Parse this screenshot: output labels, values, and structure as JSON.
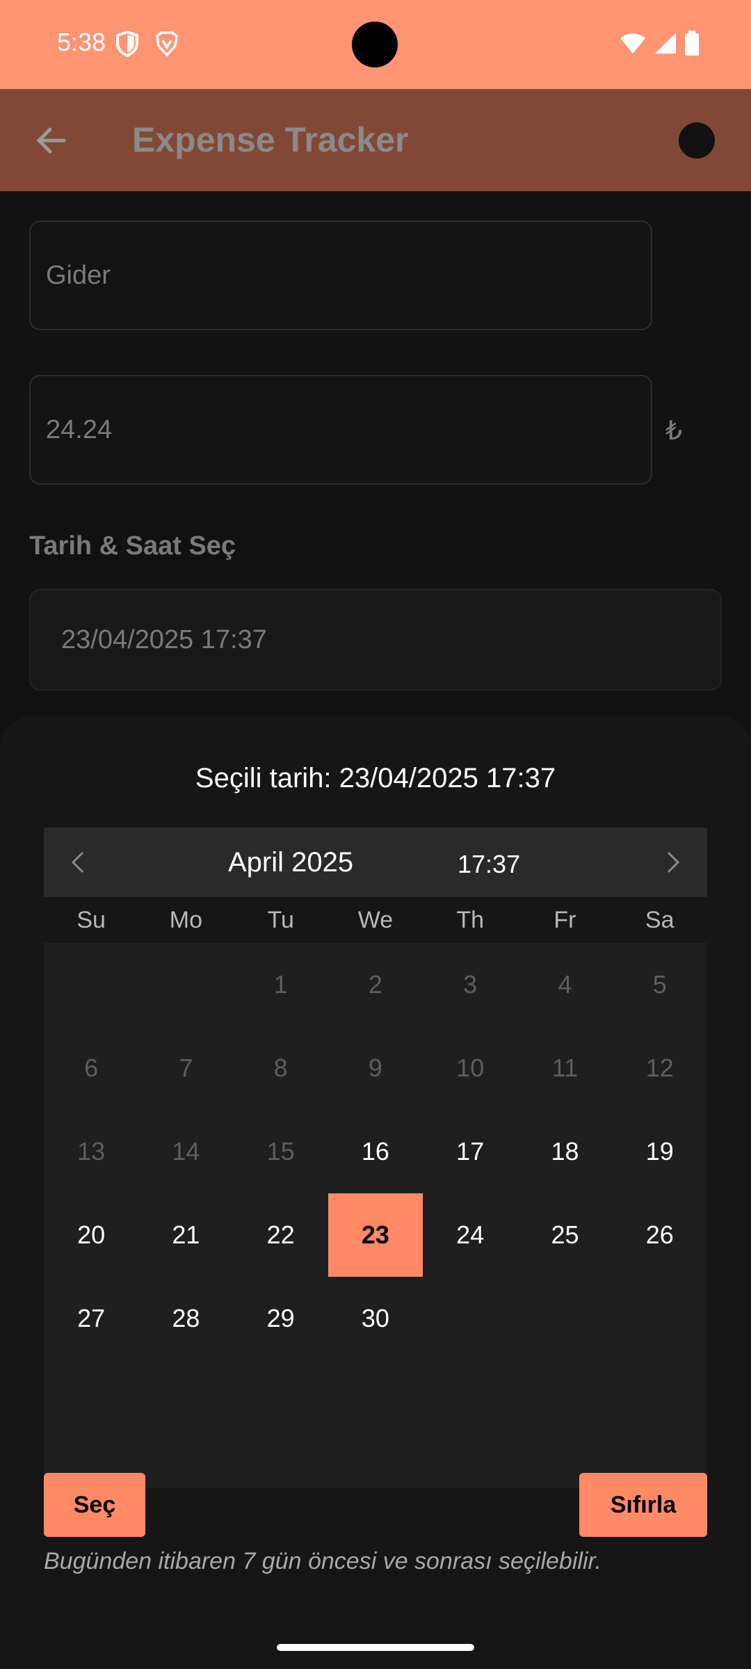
{
  "status_bar": {
    "time": "5:38",
    "background": "#FF9473",
    "icons": [
      "shield-icon",
      "brave-icon",
      "wifi-icon",
      "signal-icon",
      "battery-icon"
    ]
  },
  "app_bar": {
    "title": "Expense Tracker",
    "back_icon": "arrow-back-icon"
  },
  "form": {
    "name_value": "Gider",
    "amount_value": "24.24",
    "currency_symbol": "₺",
    "date_section_label": "Tarih & Saat Seç",
    "date_value": "23/04/2025 17:37"
  },
  "picker": {
    "selected_text": "Seçili tarih: 23/04/2025 17:37",
    "month_label": "April 2025",
    "time_label": "17:37",
    "weekdays": [
      "Su",
      "Mo",
      "Tu",
      "We",
      "Th",
      "Fr",
      "Sa"
    ],
    "days": [
      {
        "label": "",
        "state": "empty"
      },
      {
        "label": "",
        "state": "empty"
      },
      {
        "label": "1",
        "state": "disabled"
      },
      {
        "label": "2",
        "state": "disabled"
      },
      {
        "label": "3",
        "state": "disabled"
      },
      {
        "label": "4",
        "state": "disabled"
      },
      {
        "label": "5",
        "state": "disabled"
      },
      {
        "label": "6",
        "state": "disabled"
      },
      {
        "label": "7",
        "state": "disabled"
      },
      {
        "label": "8",
        "state": "disabled"
      },
      {
        "label": "9",
        "state": "disabled"
      },
      {
        "label": "10",
        "state": "disabled"
      },
      {
        "label": "11",
        "state": "disabled"
      },
      {
        "label": "12",
        "state": "disabled"
      },
      {
        "label": "13",
        "state": "disabled"
      },
      {
        "label": "14",
        "state": "disabled"
      },
      {
        "label": "15",
        "state": "disabled"
      },
      {
        "label": "16",
        "state": "enabled"
      },
      {
        "label": "17",
        "state": "enabled"
      },
      {
        "label": "18",
        "state": "enabled"
      },
      {
        "label": "19",
        "state": "enabled"
      },
      {
        "label": "20",
        "state": "enabled"
      },
      {
        "label": "21",
        "state": "enabled"
      },
      {
        "label": "22",
        "state": "enabled"
      },
      {
        "label": "23",
        "state": "selected"
      },
      {
        "label": "24",
        "state": "enabled"
      },
      {
        "label": "25",
        "state": "enabled"
      },
      {
        "label": "26",
        "state": "enabled"
      },
      {
        "label": "27",
        "state": "enabled"
      },
      {
        "label": "28",
        "state": "enabled"
      },
      {
        "label": "29",
        "state": "enabled"
      },
      {
        "label": "30",
        "state": "enabled"
      }
    ],
    "select_button": "Seç",
    "reset_button": "Sıfırla",
    "hint": "Bugünden itibaren 7 gün öncesi ve sonrası seçilebilir.",
    "accent_color": "#FF8A65"
  }
}
